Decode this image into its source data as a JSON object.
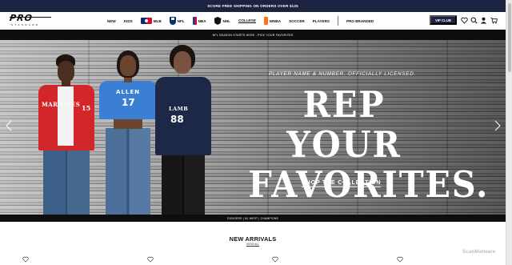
{
  "promo": {
    "text": "SCORE FREE SHIPPING ON ORDERS OVER $125"
  },
  "header": {
    "logo_text": "PRO",
    "logo_sub": "STANDARD",
    "nav": [
      {
        "label": "NEW"
      },
      {
        "label": "KIDS"
      },
      {
        "label": "MLB",
        "icon": "mlb-logo-icon"
      },
      {
        "label": "NFL",
        "icon": "nfl-logo-icon"
      },
      {
        "label": "NBA",
        "icon": "nba-logo-icon"
      },
      {
        "label": "NHL",
        "icon": "nhl-logo-icon"
      },
      {
        "label": "COLLEGE"
      },
      {
        "label": "WNBA",
        "icon": "wnba-logo-icon"
      },
      {
        "label": "SOCCER"
      },
      {
        "label": "PLAYERS"
      },
      {
        "label": "PRO BRANDED"
      }
    ],
    "vip_label": "VIP CLUB",
    "utility_icons": [
      "heart-icon",
      "search-icon",
      "account-icon",
      "cart-icon"
    ],
    "colors": {
      "navy": "#1b2340"
    }
  },
  "sub_banner": {
    "text": "NFL SEASON STARTS HERE . PICK YOUR FAVORITES"
  },
  "hero": {
    "kicker": "PLAYER NAME & NUMBER. OFFICIALLY LICENSED.",
    "headline_line1": "REP YOUR",
    "headline_line2": "FAVORITES.",
    "cta": "SHOP THE COLLECTION",
    "jerseys": [
      {
        "text": "MAR  UNES",
        "number": "15",
        "color": "#d3262b"
      },
      {
        "text": "ALLEN",
        "number": "17",
        "color": "#3a7fd3"
      },
      {
        "text": "LAMB",
        "number": "88",
        "color": "#1c2846"
      }
    ],
    "arrows": [
      "chevron-left-icon",
      "chevron-right-icon"
    ]
  },
  "hero_credit": {
    "text": "DODGERS | NL WEST | CHAMPIONS"
  },
  "new_arrivals": {
    "title": "NEW ARRIVALS",
    "link": "VIEW ALL"
  },
  "watermark": {
    "text": "ScanMalware"
  }
}
